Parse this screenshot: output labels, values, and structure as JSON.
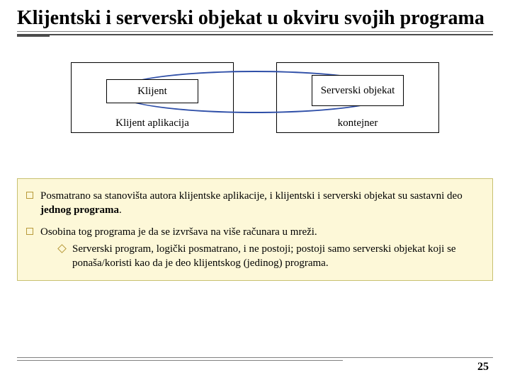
{
  "title": "Klijentski i serverski objekat u okviru svojih programa",
  "diagram": {
    "left_box_caption": "Klijent aplikacija",
    "right_box_caption": "kontejner",
    "left_inner": "Klijent",
    "right_inner": "Serverski objekat"
  },
  "bullets": [
    {
      "text_pre": "Posmatrano sa stanovišta autora klijentske aplikacije, i klijentski i serverski objekat su sastavni deo ",
      "text_bold": "jednog programa",
      "text_post": "."
    },
    {
      "text_pre": "Osobina tog programa je da se izvršava na više računara u mreži.",
      "sub": "Serverski program, logički posmatrano, i ne postoji; postoji samo serverski objekat koji se ponaša/koristi kao da je deo klijentskog (jedinog) programa."
    }
  ],
  "page_number": "25"
}
